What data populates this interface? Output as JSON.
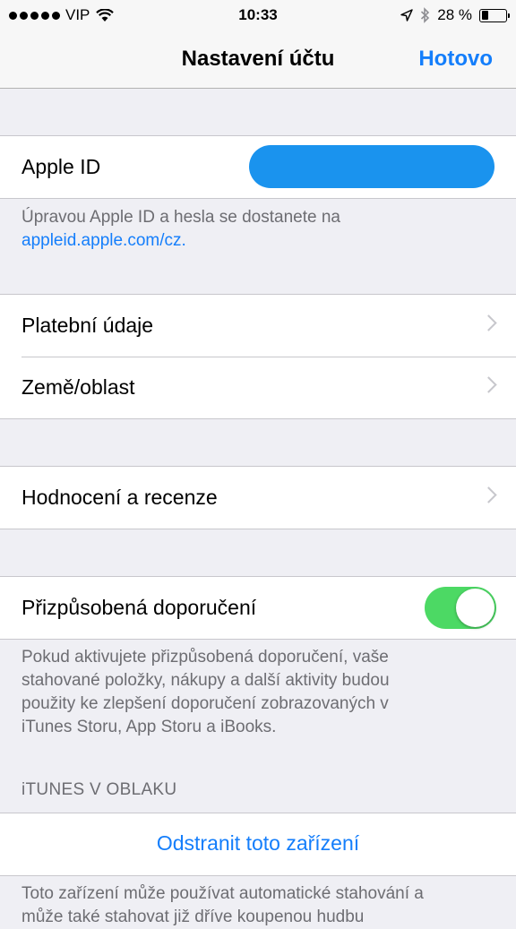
{
  "status_bar": {
    "carrier": "VIP",
    "time": "10:33",
    "battery_percent": "28 %",
    "battery_level": 0.28,
    "icons": [
      "signal-dots-icon",
      "wifi-icon",
      "location-arrow-icon",
      "bluetooth-icon",
      "battery-icon"
    ]
  },
  "nav": {
    "title": "Nastavení účtu",
    "done_label": "Hotovo"
  },
  "apple_id": {
    "label": "Apple ID",
    "footer_text": "Úpravou Apple ID a hesla se dostanete na",
    "footer_link": "appleid.apple.com/cz."
  },
  "account_group": {
    "items": [
      {
        "label": "Platební údaje"
      },
      {
        "label": "Země/oblast"
      }
    ]
  },
  "ratings": {
    "label": "Hodnocení a recenze"
  },
  "recommendations": {
    "label": "Přizpůsobená doporučení",
    "enabled": true,
    "footer_lines": [
      "Pokud aktivujete přizpůsobená doporučení, vaše",
      "stahované položky, nákupy a další aktivity budou",
      "použity ke zlepšení doporučení zobrazovaných v",
      "iTunes Storu, App Storu a iBooks."
    ]
  },
  "cloud": {
    "header": "iTUNES V OBLAKU",
    "remove_device_label": "Odstranit toto zařízení",
    "footer_lines": [
      "Toto zařízení může používat automatické stahování a",
      "může také stahovat již dříve koupenou hudbu"
    ]
  },
  "colors": {
    "accent": "#147efb",
    "toggle_on": "#4cd964",
    "background": "#efeff4"
  }
}
